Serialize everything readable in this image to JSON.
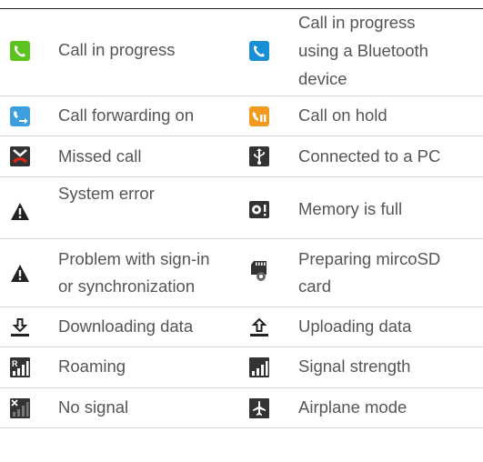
{
  "rows": [
    {
      "left": {
        "icon": "call-in-progress-green-icon",
        "label": "Call in progress"
      },
      "right": {
        "icon": "call-in-progress-bluetooth-icon",
        "lines": [
          "Call in progress",
          "using a Bluetooth",
          "device"
        ]
      }
    },
    {
      "left": {
        "icon": "call-forwarding-icon",
        "label": "Call forwarding on"
      },
      "right": {
        "icon": "call-on-hold-icon",
        "label": "Call on hold"
      }
    },
    {
      "left": {
        "icon": "missed-call-icon",
        "label": "Missed call"
      },
      "right": {
        "icon": "usb-icon",
        "label": "Connected to a PC"
      }
    },
    {
      "left": {
        "icon": "warning-icon",
        "label": "System error"
      },
      "right": {
        "icon": "memory-full-icon",
        "label": "Memory is full"
      }
    },
    {
      "left": {
        "icon": "warning-icon",
        "lines": [
          "Problem with sign-in",
          "or synchronization"
        ]
      },
      "right": {
        "icon": "sd-card-icon",
        "lines": [
          "Preparing mircoSD",
          "card"
        ]
      }
    },
    {
      "left": {
        "icon": "download-icon",
        "label": "Downloading data"
      },
      "right": {
        "icon": "upload-icon",
        "label": "Uploading data"
      }
    },
    {
      "left": {
        "icon": "roaming-signal-icon",
        "label": "Roaming"
      },
      "right": {
        "icon": "signal-strength-icon",
        "label": "Signal strength"
      }
    },
    {
      "left": {
        "icon": "no-signal-icon",
        "label": "No signal"
      },
      "right": {
        "icon": "airplane-mode-icon",
        "label": "Airplane mode"
      }
    }
  ],
  "colors": {
    "call_green": "#5cc21e",
    "call_blue": "#1a8fd6",
    "hold_orange": "#f29a1f",
    "missed_red": "#d9261c",
    "icon_dark": "#333333"
  }
}
